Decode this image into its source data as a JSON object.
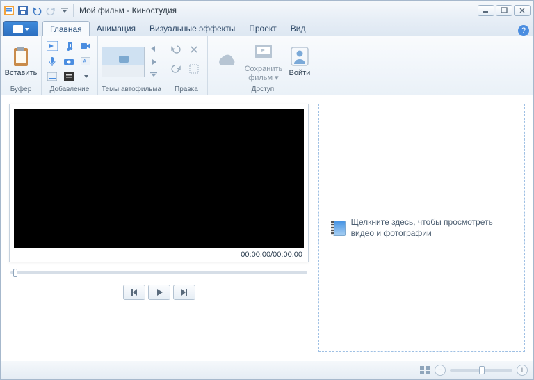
{
  "titlebar": {
    "title": "Мой фильм - Киностудия"
  },
  "tabs": {
    "home": "Главная",
    "animation": "Анимация",
    "effects": "Визуальные эффекты",
    "project": "Проект",
    "view": "Вид"
  },
  "ribbon": {
    "clipboard": {
      "paste": "Вставить",
      "group": "Буфер"
    },
    "add": {
      "group": "Добавление"
    },
    "themes": {
      "group": "Темы автофильма"
    },
    "edit": {
      "group": "Правка"
    },
    "access": {
      "save": "Сохранить фильм ▾",
      "signin": "Войти",
      "group": "Доступ"
    }
  },
  "preview": {
    "timecode": "00:00,00/00:00,00"
  },
  "storyboard": {
    "prompt": "Щелкните здесь, чтобы просмотреть видео и фотографии"
  }
}
